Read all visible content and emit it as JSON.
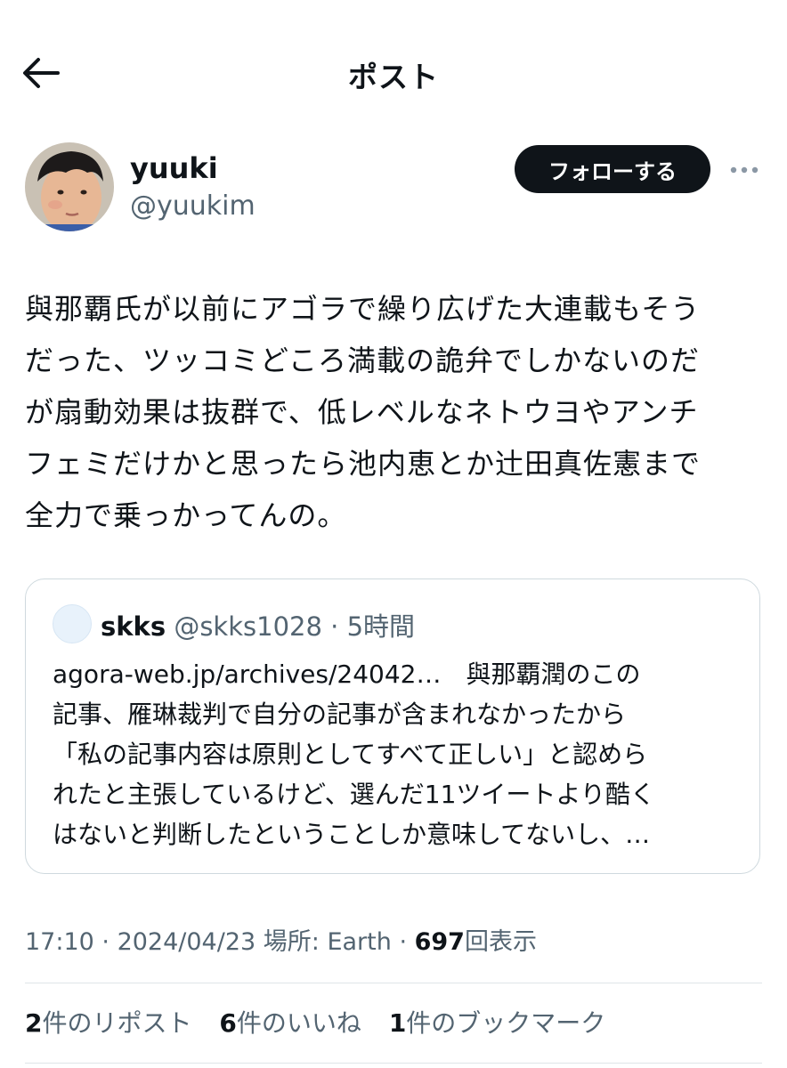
{
  "header": {
    "title": "ポスト",
    "back_icon": "arrow-left-icon"
  },
  "author": {
    "name": "yuuki",
    "handle": "@yuukim",
    "follow_label": "フォローする",
    "more_icon": "more-horizontal-icon"
  },
  "post": {
    "lines": [
      "與那覇氏が以前にアゴラで繰り広げた大連載もそう",
      "だった、ツッコミどころ満載の詭弁でしかないのだ",
      "が扇動効果は抜群で、低レベルなネトウヨやアンチ",
      "フェミだけかと思ったら池内恵とか辻田真佐憲まで",
      "全力で乗っかってんの。"
    ]
  },
  "quote": {
    "name": "skks",
    "handle": "@skks1028",
    "separator": "·",
    "time": "5時間",
    "lines": [
      "agora-web.jp/archives/24042…　與那覇潤のこの",
      "記事、雁琳裁判で自分の記事が含まれなかったから",
      "「私の記事内容は原則としてすべて正しい」と認めら",
      "れたと主張しているけど、選んだ11ツイートより酷く",
      "はないと判断したということしか意味してないし、…"
    ]
  },
  "meta": {
    "time": "17:10",
    "sep1": " · ",
    "date": "2024/04/23",
    "location": " 場所: Earth",
    "sep2": " · ",
    "views_count": "697",
    "views_label": "回表示"
  },
  "stats": {
    "reposts_count": "2",
    "reposts_label": "件のリポスト",
    "likes_count": "6",
    "likes_label": "件のいいね",
    "bookmarks_count": "1",
    "bookmarks_label": "件のブックマーク"
  }
}
